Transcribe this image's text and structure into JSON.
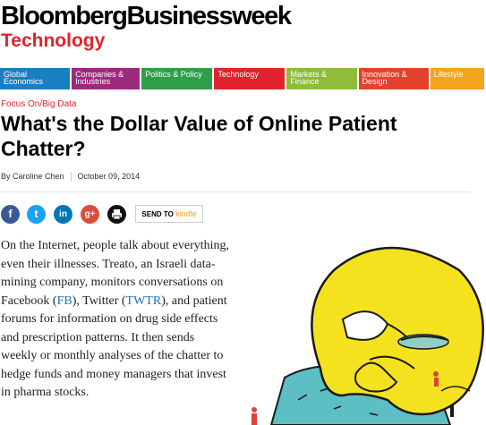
{
  "brand": {
    "name": "BloombergBusinessweek",
    "section": "Technology"
  },
  "nav": [
    {
      "label": "Global\nEconomics",
      "color": "#1a7fc0",
      "width": 79
    },
    {
      "label": "Companies &\nIndustries",
      "color": "#9c2b7e",
      "width": 77
    },
    {
      "label": "Politics & Policy",
      "color": "#2e9e4a",
      "width": 80
    },
    {
      "label": "Technology",
      "color": "#e0232e",
      "width": 80
    },
    {
      "label": "Markets &\nFinance",
      "color": "#8fbd3a",
      "width": 79
    },
    {
      "label": "Innovation &\nDesign",
      "color": "#e3432c",
      "width": 79
    },
    {
      "label": "Lifestyle",
      "color": "#f3a31c",
      "width": 61
    }
  ],
  "article": {
    "kicker": "Focus On/Big Data",
    "title": "What's the Dollar Value of Online Patient Chatter?",
    "author": "By Caroline Chen",
    "date": "October 09, 2014"
  },
  "share": {
    "facebook": "f",
    "twitter": "t",
    "linkedin": "in",
    "googleplus": "g+",
    "print": "print"
  },
  "kindle": {
    "send_to": "SEND TO",
    "kindle": "kindle"
  },
  "body": {
    "p1_a": "On the Internet, people talk about everything, even their illnesses. Treato, an Israeli data-mining company, monitors conversations on Facebook (",
    "link_fb": "FB",
    "p1_b": "), Twitter (",
    "link_twtr": "TWTR",
    "p1_c": "), and patient forums for information on drug side effects and prescription patterns. It then sends weekly or monthly analyses of the chatter to hedge funds and money managers that invest in pharma stocks."
  }
}
